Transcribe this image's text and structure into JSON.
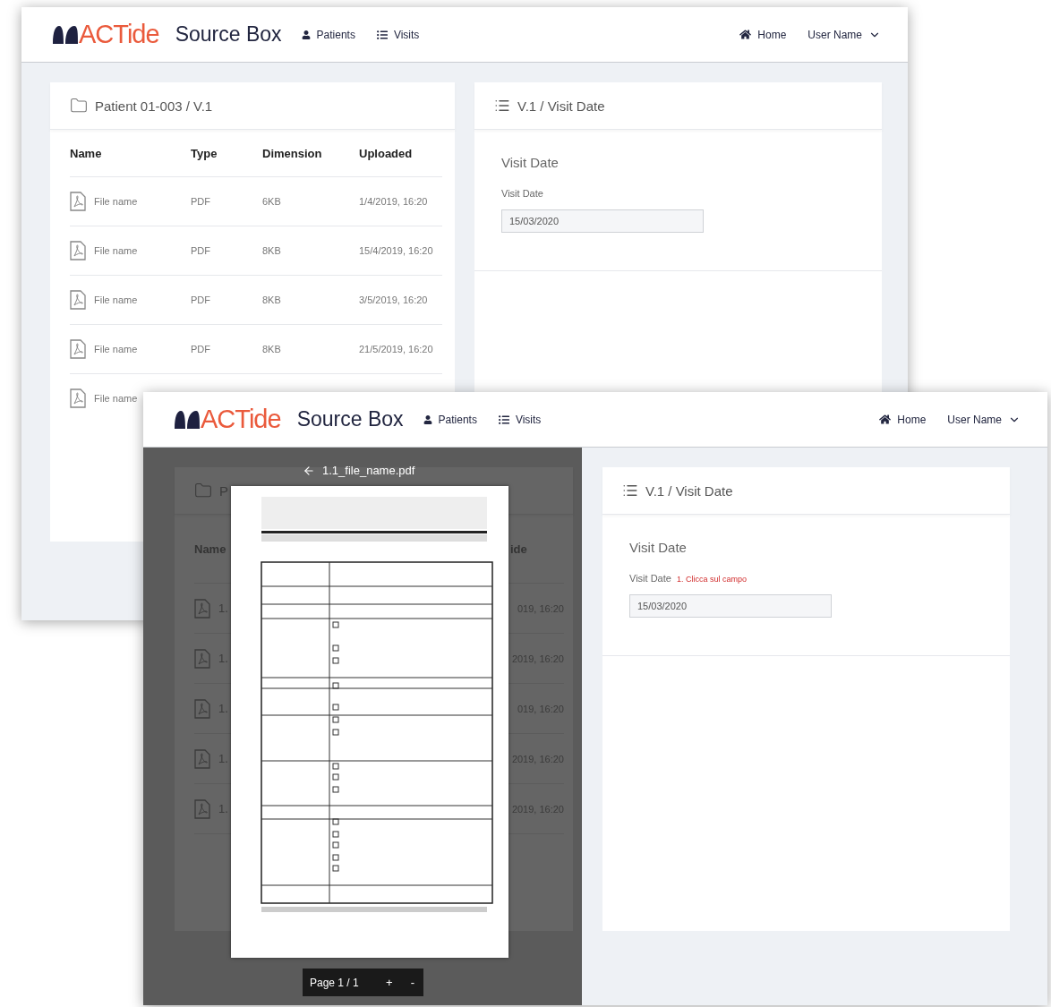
{
  "back_window": {
    "header": {
      "logo": "ACTide",
      "app_title": "Source Box",
      "nav": [
        "Patients",
        "Visits"
      ],
      "home": "Home",
      "user_menu": "User Name"
    },
    "files_panel": {
      "title": "Patient 01-003 / V.1",
      "columns": [
        "Name",
        "Type",
        "Dimension",
        "Uploaded"
      ],
      "rows": [
        {
          "name": "File name",
          "type": "PDF",
          "dimension": "6KB",
          "uploaded": "1/4/2019, 16:20"
        },
        {
          "name": "File name",
          "type": "PDF",
          "dimension": "8KB",
          "uploaded": "15/4/2019, 16:20"
        },
        {
          "name": "File name",
          "type": "PDF",
          "dimension": "8KB",
          "uploaded": "3/5/2019, 16:20"
        },
        {
          "name": "File name",
          "type": "PDF",
          "dimension": "8KB",
          "uploaded": "21/5/2019, 16:20"
        },
        {
          "name": "File name"
        }
      ]
    },
    "visit_panel": {
      "title": "V.1 / Visit Date",
      "section": "Visit Date",
      "field_label": "Visit Date",
      "value": "15/03/2020"
    }
  },
  "front_window": {
    "header": {
      "logo": "ACTide",
      "app_title": "Source Box",
      "nav": [
        "Patients",
        "Visits"
      ],
      "home": "Home",
      "user_menu": "User Name"
    },
    "files_panel": {
      "title": "P",
      "columns": [
        "Name",
        "ide"
      ],
      "rows": [
        {
          "name": "1.",
          "uploaded": "019, 16:20"
        },
        {
          "name": "1.",
          "uploaded": "2019, 16:20"
        },
        {
          "name": "1.",
          "uploaded": "019, 16:20"
        },
        {
          "name": "1.",
          "uploaded": "2019, 16:20"
        },
        {
          "name": "1.",
          "uploaded": "2019, 16:20"
        }
      ]
    },
    "viewer": {
      "file_name": "1.1_file_name.pdf",
      "pager": {
        "label": "Page 1 / 1",
        "zoom_in": "+",
        "zoom_out": "-"
      }
    },
    "visit_panel": {
      "title": "V.1 / Visit Date",
      "section": "Visit Date",
      "field_label": "Visit Date",
      "hint": "1. Clicca sul campo",
      "value": "15/03/2020"
    }
  }
}
